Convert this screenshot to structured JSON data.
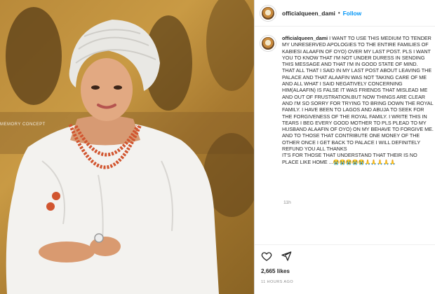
{
  "photo": {
    "watermark": "MEMORY CONCEPT"
  },
  "header": {
    "username": "officialqueen_dami",
    "dot": "•",
    "follow_label": "Follow"
  },
  "caption": {
    "username": "officialqueen_dami",
    "text": " I WANT TO USE THIS MEDIUM TO TENDER MY UNRESERVED APOLOGIES TO THE ENTIRE FAMILIES OF KABIESI ALAAFIN OF OYO) OVER MY LAST POST. PLS I WANT YOU TO KNOW THAT I'M NOT UNDER DURESS IN SENDING THIS MESSAGE AND THAT I'M IN GOOD STATE OF MIND.\nTHAT ALL THAT I SAID IN MY LAST POST ABOUT LEAVING THE PALACE AND THAT ALAAFIN WAS NOT TAKING CARE OF ME AND ALL WHAT I SAID NEGATIVELY CONCERNING HIM(ALAAFIN) IS FALSE IT WAS FRIENDS THAT MISLEAD ME AND OUT OF FRUSTRATION.BUT NOW THINGS ARE CLEAR AND I'M SO SORRY FOR TRYING TO BRING DOWN THE ROYAL FAMILY. I HAVE BEEN TO LAGOS AND ABUJA TO SEEK FOR THE FORGIVENESS OF THE ROYAL FAMILY. I WRITE THIS IN TEARS I BEG EVERY GOOD MOTHER TO PLS PLEAD TO MY HUSBAND ALAAFIN OF OYO) ON MY BEHAVE TO FORGIVE ME. AND TO THOSE THAT CONTRIBUTE ONE MONEY OF THE OTHER ONCE I GET BACK TO PALACE I WILL DEFINITELY REFUND YOU ALL THANKS\nIT'S FOR THOSE THAT UNDERSTAND THAT THEIR IS NO PLACE LIKE HOME ...😭😭😭😭😭🙏🙏🙏🙏🙏",
    "time_ago": "11h"
  },
  "actions": {
    "like_icon": "heart-icon",
    "share_icon": "send-icon",
    "likes": "2,665 likes",
    "posted": "11 HOURS AGO"
  }
}
